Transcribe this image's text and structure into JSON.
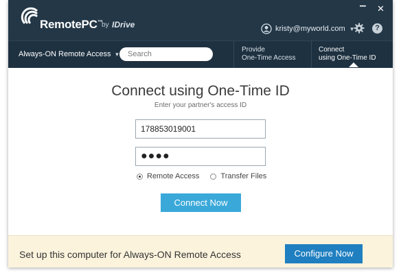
{
  "titlebar": {
    "brand": "RemotePC",
    "brand_tm": "™",
    "by": "by",
    "partner": "IDrive",
    "minimize_label": "‒",
    "close_label": "✕",
    "user_email": "kristy@myworld.com",
    "help_label": "?"
  },
  "nav": {
    "menu_label": "Always-ON Remote Access",
    "search_placeholder": "Search",
    "tabs": [
      {
        "line1": "Provide",
        "line2": "One-Time Access"
      },
      {
        "line1": "Connect",
        "line2": "using One-Time ID"
      }
    ]
  },
  "main": {
    "title": "Connect using One-Time ID",
    "subtitle": "Enter your partner's access ID",
    "access_id": "178853019001",
    "password_mask": "●●●●",
    "radio_options": [
      "Remote Access",
      "Transfer Files"
    ],
    "selected_option": "Remote Access",
    "connect_label": "Connect Now"
  },
  "footer": {
    "text": "Set up this computer for Always-ON Remote Access",
    "configure_label": "Configure Now"
  },
  "colors": {
    "titlebar_bg": "#233747",
    "nav_bg": "#1e3141",
    "connect_button": "#3aa9da",
    "configure_button": "#1f7fc0",
    "footer_bg": "#fbf3dc"
  }
}
